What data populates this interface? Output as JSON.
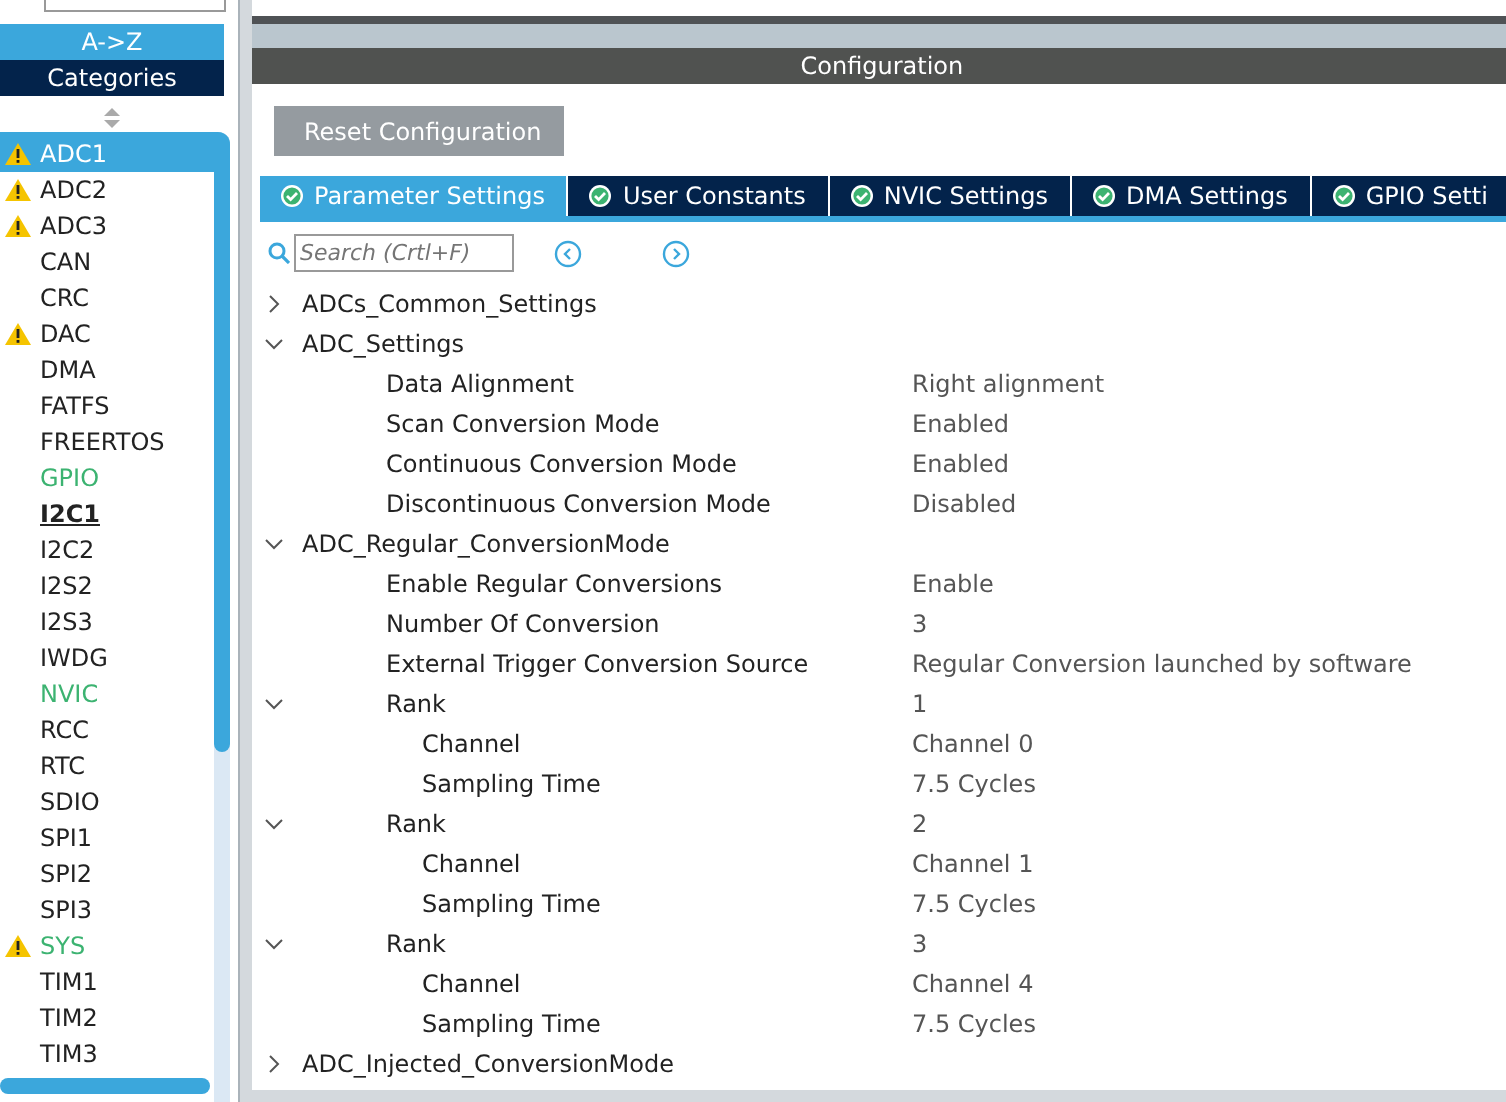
{
  "sidebar": {
    "sort_button": "A->Z",
    "categories_button": "Categories",
    "items": [
      {
        "label": "ADC1",
        "warning": true,
        "selected": true,
        "emphasis": false
      },
      {
        "label": "ADC2",
        "warning": true,
        "selected": false,
        "color": "#222222",
        "emphasis": false
      },
      {
        "label": "ADC3",
        "warning": true,
        "selected": false,
        "color": "#222222",
        "emphasis": false
      },
      {
        "label": "CAN",
        "warning": false,
        "selected": false,
        "color": "#222222",
        "emphasis": false
      },
      {
        "label": "CRC",
        "warning": false,
        "selected": false,
        "color": "#222222",
        "emphasis": false
      },
      {
        "label": "DAC",
        "warning": true,
        "selected": false,
        "color": "#222222",
        "emphasis": false
      },
      {
        "label": "DMA",
        "warning": false,
        "selected": false,
        "color": "#222222",
        "emphasis": false
      },
      {
        "label": "FATFS",
        "warning": false,
        "selected": false,
        "color": "#222222",
        "emphasis": false
      },
      {
        "label": "FREERTOS",
        "warning": false,
        "selected": false,
        "color": "#222222",
        "emphasis": false
      },
      {
        "label": "GPIO",
        "warning": false,
        "selected": false,
        "color": "#3cb371",
        "emphasis": false
      },
      {
        "label": "I2C1",
        "warning": false,
        "selected": false,
        "color": "#222222",
        "emphasis": true
      },
      {
        "label": "I2C2",
        "warning": false,
        "selected": false,
        "color": "#222222",
        "emphasis": false
      },
      {
        "label": "I2S2",
        "warning": false,
        "selected": false,
        "color": "#222222",
        "emphasis": false
      },
      {
        "label": "I2S3",
        "warning": false,
        "selected": false,
        "color": "#222222",
        "emphasis": false
      },
      {
        "label": "IWDG",
        "warning": false,
        "selected": false,
        "color": "#222222",
        "emphasis": false
      },
      {
        "label": "NVIC",
        "warning": false,
        "selected": false,
        "color": "#3cb371",
        "emphasis": false
      },
      {
        "label": "RCC",
        "warning": false,
        "selected": false,
        "color": "#222222",
        "emphasis": false
      },
      {
        "label": "RTC",
        "warning": false,
        "selected": false,
        "color": "#222222",
        "emphasis": false
      },
      {
        "label": "SDIO",
        "warning": false,
        "selected": false,
        "color": "#222222",
        "emphasis": false
      },
      {
        "label": "SPI1",
        "warning": false,
        "selected": false,
        "color": "#222222",
        "emphasis": false
      },
      {
        "label": "SPI2",
        "warning": false,
        "selected": false,
        "color": "#222222",
        "emphasis": false
      },
      {
        "label": "SPI3",
        "warning": false,
        "selected": false,
        "color": "#222222",
        "emphasis": false
      },
      {
        "label": "SYS",
        "warning": true,
        "selected": false,
        "color": "#3cb371",
        "emphasis": false
      },
      {
        "label": "TIM1",
        "warning": false,
        "selected": false,
        "color": "#222222",
        "emphasis": false
      },
      {
        "label": "TIM2",
        "warning": false,
        "selected": false,
        "color": "#222222",
        "emphasis": false
      },
      {
        "label": "TIM3",
        "warning": false,
        "selected": false,
        "color": "#222222",
        "emphasis": false
      }
    ]
  },
  "configuration": {
    "title": "Configuration",
    "reset_button": "Reset Configuration",
    "tabs": [
      {
        "label": "Parameter Settings",
        "selected": true
      },
      {
        "label": "User Constants",
        "selected": false
      },
      {
        "label": "NVIC Settings",
        "selected": false
      },
      {
        "label": "DMA Settings",
        "selected": false
      },
      {
        "label": "GPIO Setti",
        "selected": false
      }
    ],
    "search": {
      "placeholder": "Search (Crtl+F)"
    },
    "tree": [
      {
        "label": "ADCs_Common_Settings",
        "expanded": false
      },
      {
        "label": "ADC_Settings",
        "expanded": true,
        "children": [
          {
            "label": "Data Alignment",
            "value": "Right alignment"
          },
          {
            "label": "Scan Conversion Mode",
            "value": "Enabled"
          },
          {
            "label": "Continuous Conversion Mode",
            "value": "Enabled"
          },
          {
            "label": "Discontinuous Conversion Mode",
            "value": "Disabled"
          }
        ]
      },
      {
        "label": "ADC_Regular_ConversionMode",
        "expanded": true,
        "children": [
          {
            "label": "Enable Regular Conversions",
            "value": "Enable"
          },
          {
            "label": "Number Of Conversion",
            "value": "3"
          },
          {
            "label": "External Trigger Conversion Source",
            "value": "Regular Conversion launched by software"
          },
          {
            "label": "Rank",
            "value": "1",
            "expanded": true,
            "children": [
              {
                "label": "Channel",
                "value": "Channel 0"
              },
              {
                "label": "Sampling Time",
                "value": "7.5 Cycles"
              }
            ]
          },
          {
            "label": "Rank",
            "value": "2",
            "expanded": true,
            "children": [
              {
                "label": "Channel",
                "value": "Channel 1"
              },
              {
                "label": "Sampling Time",
                "value": "7.5 Cycles"
              }
            ]
          },
          {
            "label": "Rank",
            "value": "3",
            "expanded": true,
            "children": [
              {
                "label": "Channel",
                "value": "Channel 4"
              },
              {
                "label": "Sampling Time",
                "value": "7.5 Cycles"
              }
            ]
          }
        ]
      },
      {
        "label": "ADC_Injected_ConversionMode",
        "expanded": false
      }
    ]
  }
}
